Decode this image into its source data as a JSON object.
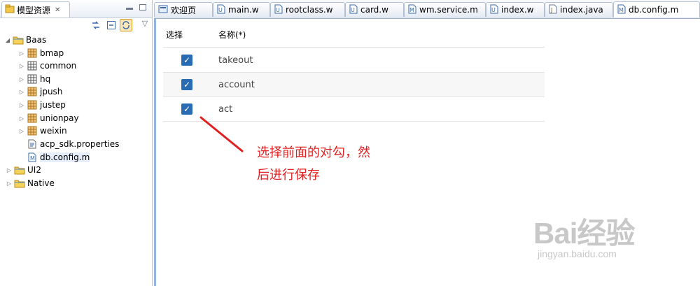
{
  "left_panel": {
    "tab_label": "模型资源",
    "tree": [
      {
        "label": "Baas",
        "expanded": true,
        "level": 0,
        "icon": "folder-icon"
      },
      {
        "label": "bmap",
        "level": 1,
        "icon": "package-icon"
      },
      {
        "label": "common",
        "level": 1,
        "icon": "package-link-icon"
      },
      {
        "label": "hq",
        "level": 1,
        "icon": "package-link-icon"
      },
      {
        "label": "jpush",
        "level": 1,
        "icon": "package-icon"
      },
      {
        "label": "justep",
        "level": 1,
        "icon": "package-icon"
      },
      {
        "label": "unionpay",
        "level": 1,
        "icon": "package-icon"
      },
      {
        "label": "weixin",
        "level": 1,
        "icon": "package-icon"
      },
      {
        "label": "acp_sdk.properties",
        "level": 1,
        "icon": "properties-file-icon"
      },
      {
        "label": "db.config.m",
        "level": 1,
        "icon": "model-file-icon",
        "selected": true
      },
      {
        "label": "UI2",
        "level": 0,
        "icon": "folder-icon"
      },
      {
        "label": "Native",
        "level": 0,
        "icon": "folder-icon"
      }
    ]
  },
  "editor_tabs": [
    {
      "label": "欢迎页",
      "icon": "welcome-icon"
    },
    {
      "label": "main.w",
      "icon": "w-file-icon"
    },
    {
      "label": "rootclass.w",
      "icon": "w-file-icon"
    },
    {
      "label": "card.w",
      "icon": "w-file-icon"
    },
    {
      "label": "wm.service.m",
      "icon": "m-file-icon"
    },
    {
      "label": "index.w",
      "icon": "w-file-icon"
    },
    {
      "label": "index.java",
      "icon": "java-file-icon"
    },
    {
      "label": "db.config.m",
      "icon": "m-file-icon",
      "active": true
    }
  ],
  "table": {
    "col_select": "选择",
    "col_name": "名称(*)",
    "rows": [
      {
        "checked": true,
        "name": "takeout"
      },
      {
        "checked": true,
        "name": "account"
      },
      {
        "checked": true,
        "name": "act"
      }
    ]
  },
  "annotation": {
    "line1": "选择前面的对勾，然",
    "line2": "后进行保存",
    "color": "#e02020"
  },
  "watermark": {
    "brand": "Bai经验",
    "url": "jingyan.baidu.com"
  },
  "colors": {
    "checkbox": "#2a6cb3",
    "accent_border": "#8fb4e0"
  }
}
